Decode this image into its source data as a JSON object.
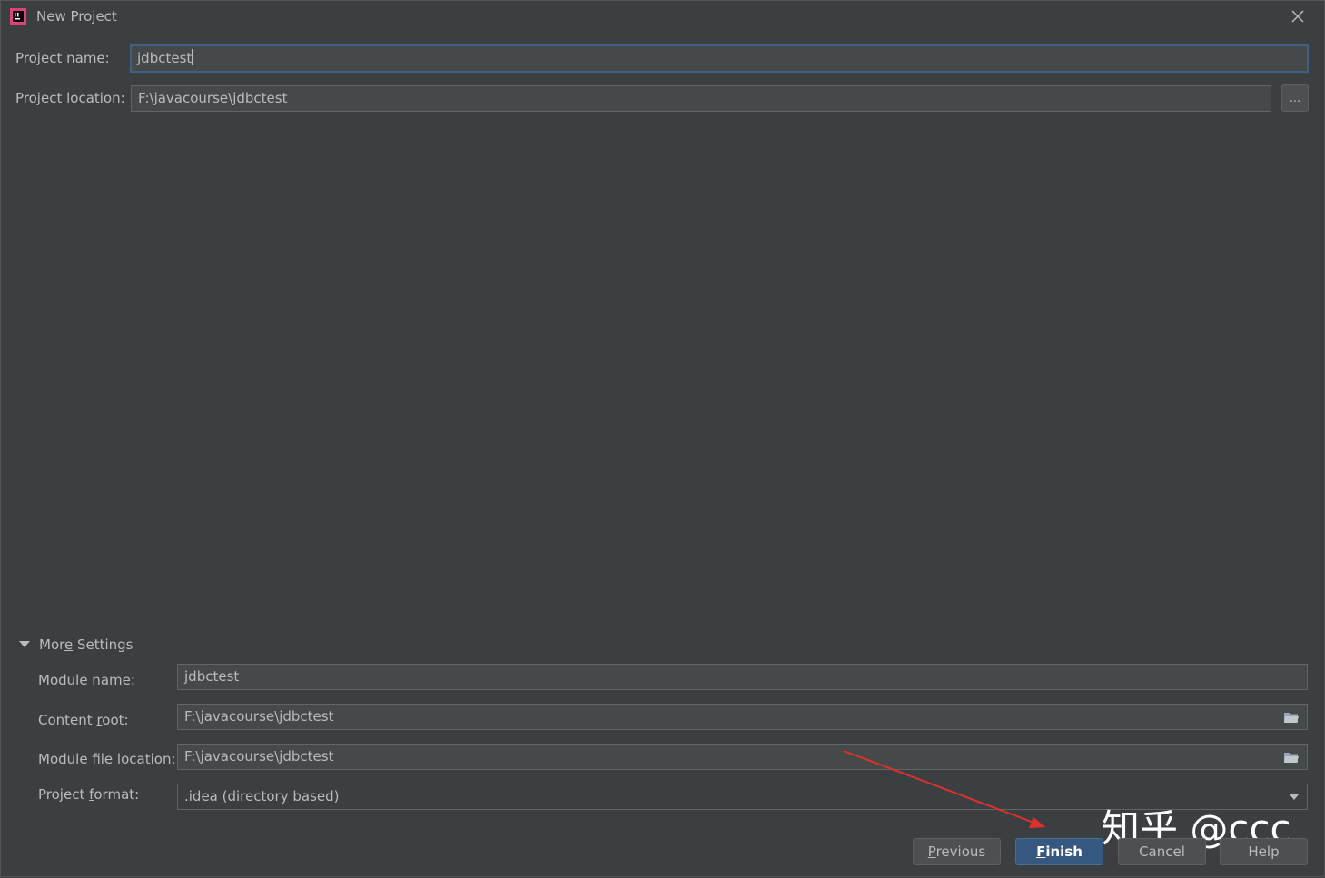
{
  "window": {
    "title": "New Project",
    "app_icon": "intellij-icon",
    "close_icon": "close-icon"
  },
  "form": {
    "project_name": {
      "label_pre": "Project n",
      "label_mn": "a",
      "label_post": "me:",
      "value": "jdbctest"
    },
    "project_location": {
      "label_pre": "Project ",
      "label_mn": "l",
      "label_post": "ocation:",
      "value": "F:\\javacourse\\jdbctest",
      "browse_label": "..."
    }
  },
  "more_settings": {
    "title_pre": "Mor",
    "title_mn": "e",
    "title_post": " Settings",
    "expanded": true,
    "module_name": {
      "label_pre": "Module na",
      "label_mn": "m",
      "label_post": "e:",
      "value": "jdbctest"
    },
    "content_root": {
      "label_pre": "Content ",
      "label_mn": "r",
      "label_post": "oot:",
      "value": "F:\\javacourse\\jdbctest"
    },
    "module_file_location": {
      "label_pre": "Mod",
      "label_mn": "u",
      "label_post": "le file location:",
      "value": "F:\\javacourse\\jdbctest"
    },
    "project_format": {
      "label_pre": "Project ",
      "label_mn": "f",
      "label_post": "ormat:",
      "value": ".idea (directory based)"
    }
  },
  "buttons": {
    "previous": {
      "mn": "P",
      "rest": "revious"
    },
    "finish": {
      "mn": "F",
      "rest": "inish"
    },
    "cancel": "Cancel",
    "help": "Help"
  },
  "watermark": "知乎 @ccc",
  "colors": {
    "background": "#3c3f41",
    "field": "#45494a",
    "accent": "#365880",
    "annotation_arrow": "#e0302a"
  }
}
